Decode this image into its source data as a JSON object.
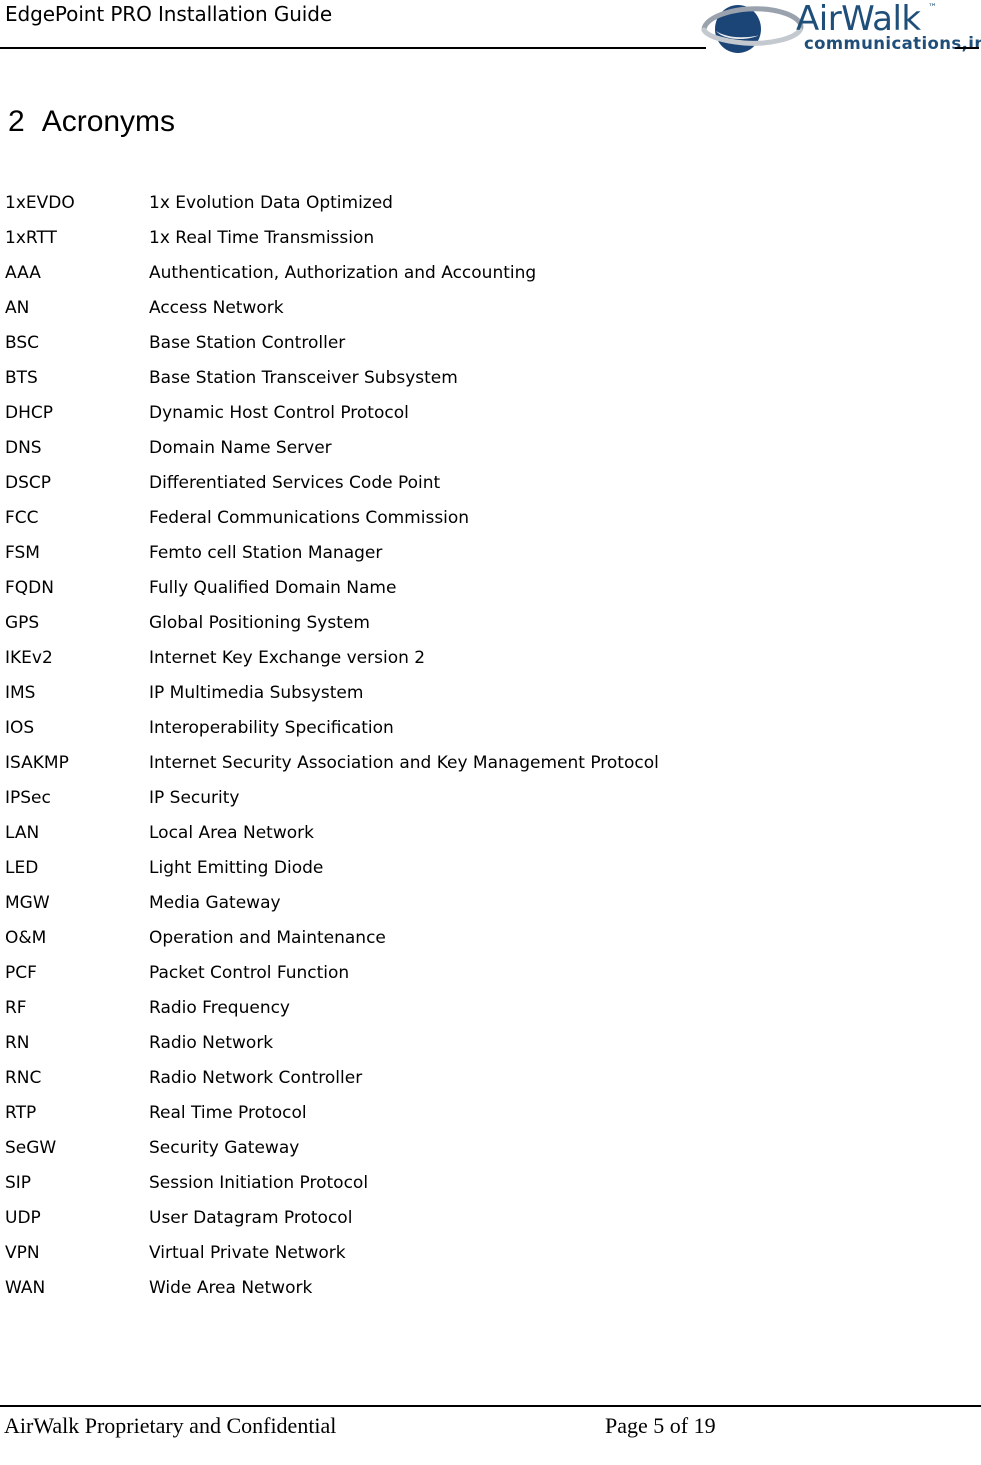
{
  "header": {
    "title": "EdgePoint PRO Installation Guide",
    "logo": {
      "wordmark": "AirWalk",
      "trademark": "™",
      "tagline": "communications,inc.",
      "brand_color": "#1f4e79",
      "globe_color": "#1b4477",
      "ring_color": "#9aa3ad"
    }
  },
  "section": {
    "number": "2",
    "title": "Acronyms"
  },
  "acronyms": [
    {
      "term": "1xEVDO",
      "definition": "1x Evolution Data Optimized"
    },
    {
      "term": "1xRTT",
      "definition": "1x Real Time Transmission"
    },
    {
      "term": "AAA",
      "definition": "Authentication, Authorization and Accounting"
    },
    {
      "term": "AN",
      "definition": "Access Network"
    },
    {
      "term": "BSC",
      "definition": "Base Station Controller"
    },
    {
      "term": "BTS",
      "definition": "Base Station Transceiver Subsystem"
    },
    {
      "term": "DHCP",
      "definition": "Dynamic Host Control Protocol"
    },
    {
      "term": "DNS",
      "definition": "Domain Name Server"
    },
    {
      "term": "DSCP",
      "definition": "Differentiated Services Code Point"
    },
    {
      "term": "FCC",
      "definition": "Federal Communications Commission"
    },
    {
      "term": "FSM",
      "definition": "Femto cell Station Manager"
    },
    {
      "term": "FQDN",
      "definition": "Fully Qualified Domain Name"
    },
    {
      "term": "GPS",
      "definition": "Global Positioning System"
    },
    {
      "term": "IKEv2",
      "definition": "Internet Key Exchange version 2"
    },
    {
      "term": "IMS",
      "definition": "IP Multimedia Subsystem"
    },
    {
      "term": "IOS",
      "definition": "Interoperability Specification"
    },
    {
      "term": "ISAKMP",
      "definition": "Internet Security Association and Key Management Protocol"
    },
    {
      "term": "IPSec",
      "definition": "IP Security"
    },
    {
      "term": "LAN",
      "definition": "Local Area Network"
    },
    {
      "term": "LED",
      "definition": "Light Emitting Diode"
    },
    {
      "term": "MGW",
      "definition": "Media Gateway"
    },
    {
      "term": "O&M",
      "definition": "Operation and Maintenance"
    },
    {
      "term": "PCF",
      "definition": "Packet Control Function"
    },
    {
      "term": "RF",
      "definition": "Radio Frequency"
    },
    {
      "term": "RN",
      "definition": "Radio Network"
    },
    {
      "term": "RNC",
      "definition": "Radio Network Controller"
    },
    {
      "term": "RTP",
      "definition": "Real Time Protocol"
    },
    {
      "term": "SeGW",
      "definition": "Security Gateway"
    },
    {
      "term": "SIP",
      "definition": "Session Initiation Protocol"
    },
    {
      "term": "UDP",
      "definition": "User Datagram Protocol"
    },
    {
      "term": "VPN",
      "definition": "Virtual Private Network"
    },
    {
      "term": "WAN",
      "definition": "Wide Area Network"
    }
  ],
  "footer": {
    "left": "AirWalk Proprietary and Confidential",
    "page": "Page 5 of 19"
  }
}
